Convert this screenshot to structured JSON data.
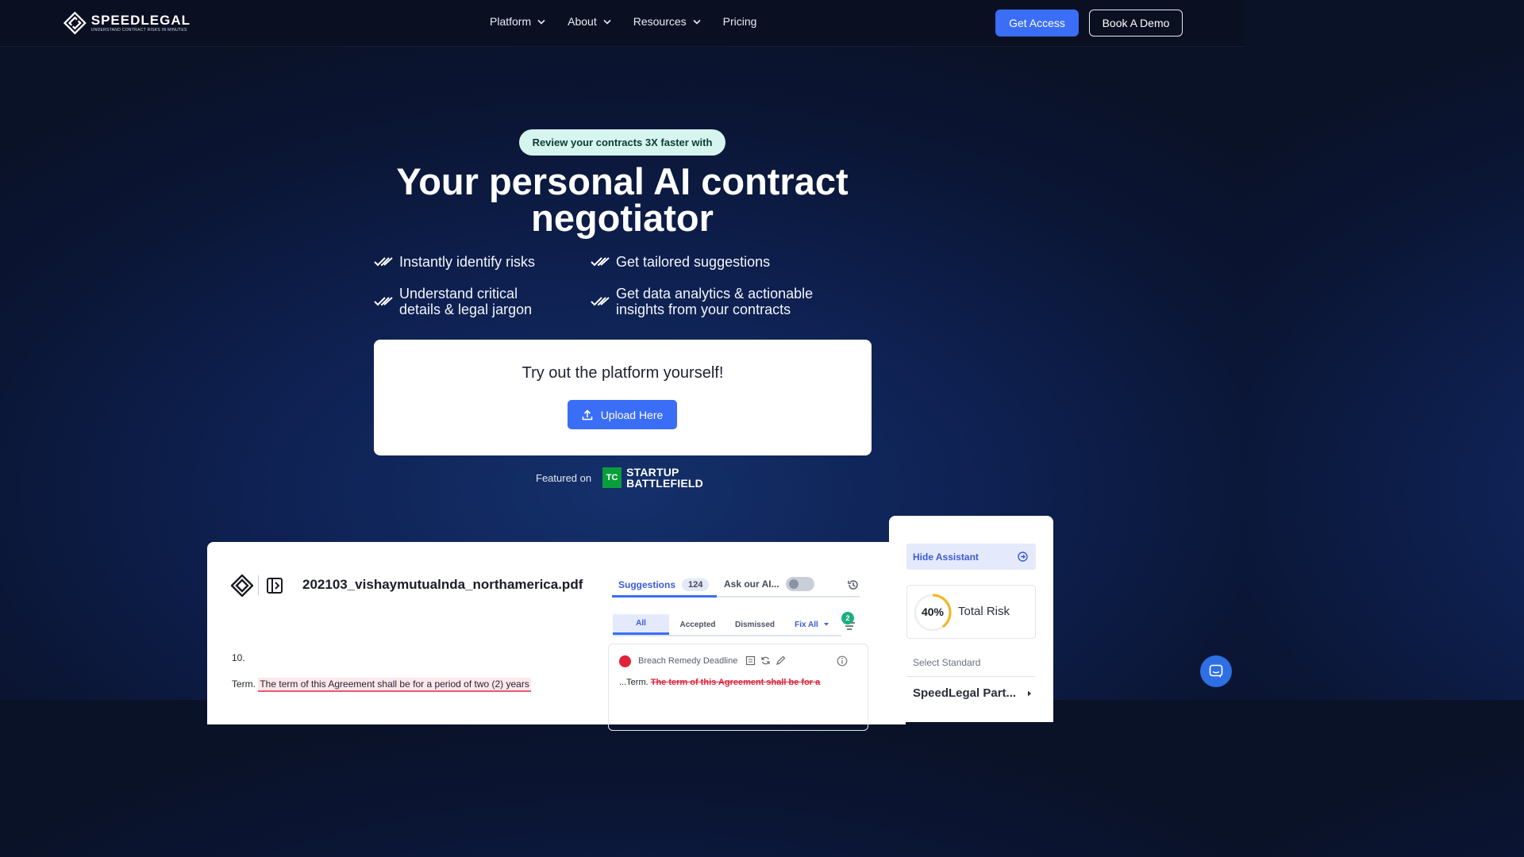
{
  "nav": {
    "logo_name": "SPEEDLEGAL",
    "logo_tagline": "UNDERSTAND CONTRACT RISKS IN MINUTES",
    "links": [
      {
        "label": "Platform",
        "has_dropdown": true
      },
      {
        "label": "About",
        "has_dropdown": true
      },
      {
        "label": "Resources",
        "has_dropdown": true
      },
      {
        "label": "Pricing",
        "has_dropdown": false
      }
    ],
    "get_access": "Get Access",
    "book_demo": "Book A Demo"
  },
  "hero": {
    "pill": "Review your contracts 3X faster with",
    "headline_line1": "Your personal AI contract",
    "headline_line2": "negotiator",
    "features": [
      {
        "line1": "Instantly identify risks",
        "line2": ""
      },
      {
        "line1": "Get tailored suggestions",
        "line2": ""
      },
      {
        "line1": "Understand critical",
        "line2": "details & legal jargon"
      },
      {
        "line1": "Get data analytics & actionable",
        "line2": "insights from your contracts"
      }
    ]
  },
  "try_box": {
    "title": "Try out the platform yourself!",
    "upload_label": "Upload Here"
  },
  "featured": {
    "label": "Featured on",
    "tc_mark": "TC",
    "brand_line1": "STARTUP",
    "brand_line2": "BATTLEFIELD"
  },
  "preview": {
    "filename": "202103_vishaymutualnda_northamerica.pdf",
    "section_number": "10.",
    "term_prefix": "Term.",
    "term_highlight": "The term of this Agreement shall be for a period of two (2) years",
    "tabs": {
      "suggestions": "Suggestions",
      "suggestions_count": "124",
      "ask_ai": "Ask our AI..."
    },
    "sub_tabs": [
      "All",
      "Accepted",
      "Dismissed",
      "Fix All"
    ],
    "filter_badge": "2",
    "card": {
      "title": "Breach Remedy Deadline",
      "text_prefix": "...Term.",
      "text_struck": "The term of this Agreement shall be for a"
    }
  },
  "assistant": {
    "hide_label": "Hide Assistant",
    "risk_percent": "40%",
    "risk_value": 0.4,
    "risk_label": "Total Risk",
    "select_standard": "Select Standard",
    "standard_value": "SpeedLegal Part..."
  },
  "colors": {
    "accent": "#3b6ef6",
    "pill_bg": "#d6f5ee",
    "risk_red": "#e0243b",
    "risk_ring": "#f2b51d",
    "badge_green": "#1faf7c"
  }
}
